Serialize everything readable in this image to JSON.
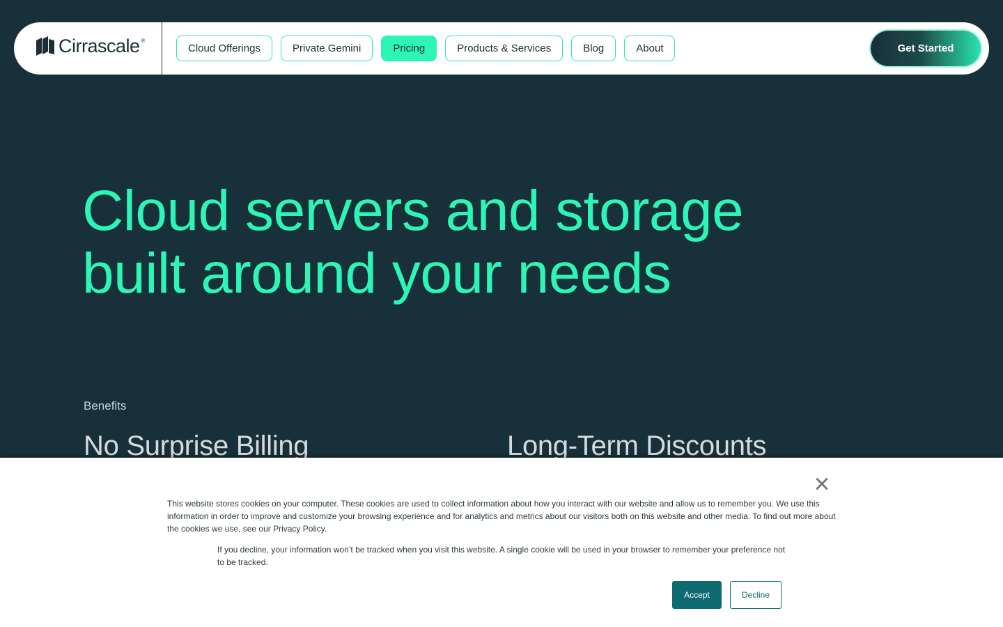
{
  "brand": {
    "name": "Cirrascale",
    "registered_mark": "®"
  },
  "nav": {
    "items": [
      {
        "label": "Cloud Offerings",
        "active": false
      },
      {
        "label": "Private Gemini",
        "active": false
      },
      {
        "label": "Pricing",
        "active": true
      },
      {
        "label": "Products & Services",
        "active": false
      },
      {
        "label": "Blog",
        "active": false
      },
      {
        "label": "About",
        "active": false
      }
    ],
    "cta_label": "Get Started"
  },
  "hero": {
    "title_line1": "Cloud servers and storage",
    "title_line2": "built around your needs"
  },
  "benefits": {
    "section_label": "Benefits",
    "items": [
      {
        "title": "No Surprise Billing"
      },
      {
        "title": "Long-Term Discounts"
      }
    ]
  },
  "cookie_banner": {
    "main_text": "This website stores cookies on your computer. These cookies are used to collect information about how you interact with our website and allow us to remember you. We use this information in order to improve and customize your browsing experience and for analytics and metrics about our visitors both on this website and other media. To find out more about the cookies we use, see our Privacy Policy.",
    "secondary_text": "If you decline, your information won’t be tracked when you visit this website. A single cookie will be used in your browser to remember your preference not to be tracked.",
    "accept_label": "Accept",
    "decline_label": "Decline"
  },
  "colors": {
    "background": "#18303a",
    "accent": "#2df5b5",
    "cookie_button": "#0f6b72"
  }
}
